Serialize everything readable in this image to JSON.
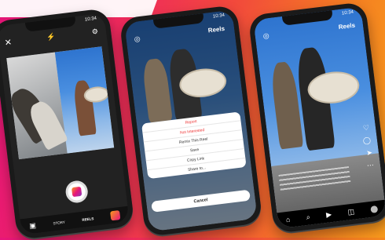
{
  "phones": [
    {
      "time": "10:34",
      "mode_tabs": [
        "STORY",
        "REELS"
      ]
    },
    {
      "time": "10:34",
      "title": "Reels",
      "sheet_items": [
        "Report",
        "Not Interested",
        "Remix This Reel",
        "Save",
        "Copy Link",
        "Share to..."
      ],
      "cancel_label": "Cancel"
    },
    {
      "time": "10:34",
      "title": "Reels"
    }
  ],
  "colors": {
    "gradient_start": "#e8157a",
    "gradient_end": "#f89a1c"
  }
}
